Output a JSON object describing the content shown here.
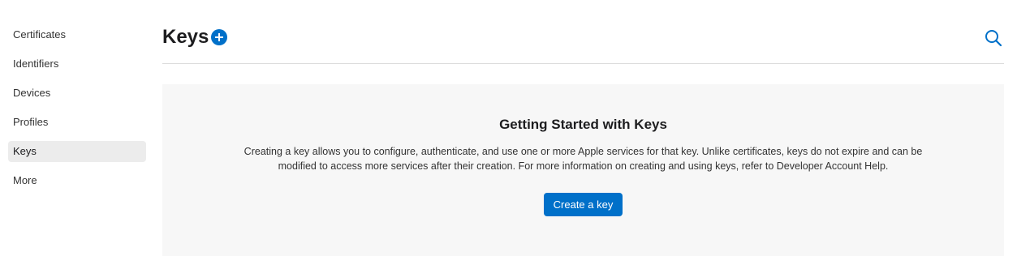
{
  "sidebar": {
    "items": [
      {
        "label": "Certificates"
      },
      {
        "label": "Identifiers"
      },
      {
        "label": "Devices"
      },
      {
        "label": "Profiles"
      },
      {
        "label": "Keys",
        "active": true
      },
      {
        "label": "More"
      }
    ]
  },
  "header": {
    "title": "Keys",
    "add_icon": "plus-circle-icon",
    "search_icon": "search-icon"
  },
  "main": {
    "title": "Getting Started with Keys",
    "description": "Creating a key allows you to configure, authenticate, and use one or more Apple services for that key. Unlike certificates, keys do not expire and can be modified to access more services after their creation. For more information on creating and using keys, refer to Developer Account Help.",
    "create_button_label": "Create a key"
  },
  "colors": {
    "accent": "#0070c9",
    "active_bg": "#ececec",
    "panel_bg": "#f7f7f7"
  }
}
